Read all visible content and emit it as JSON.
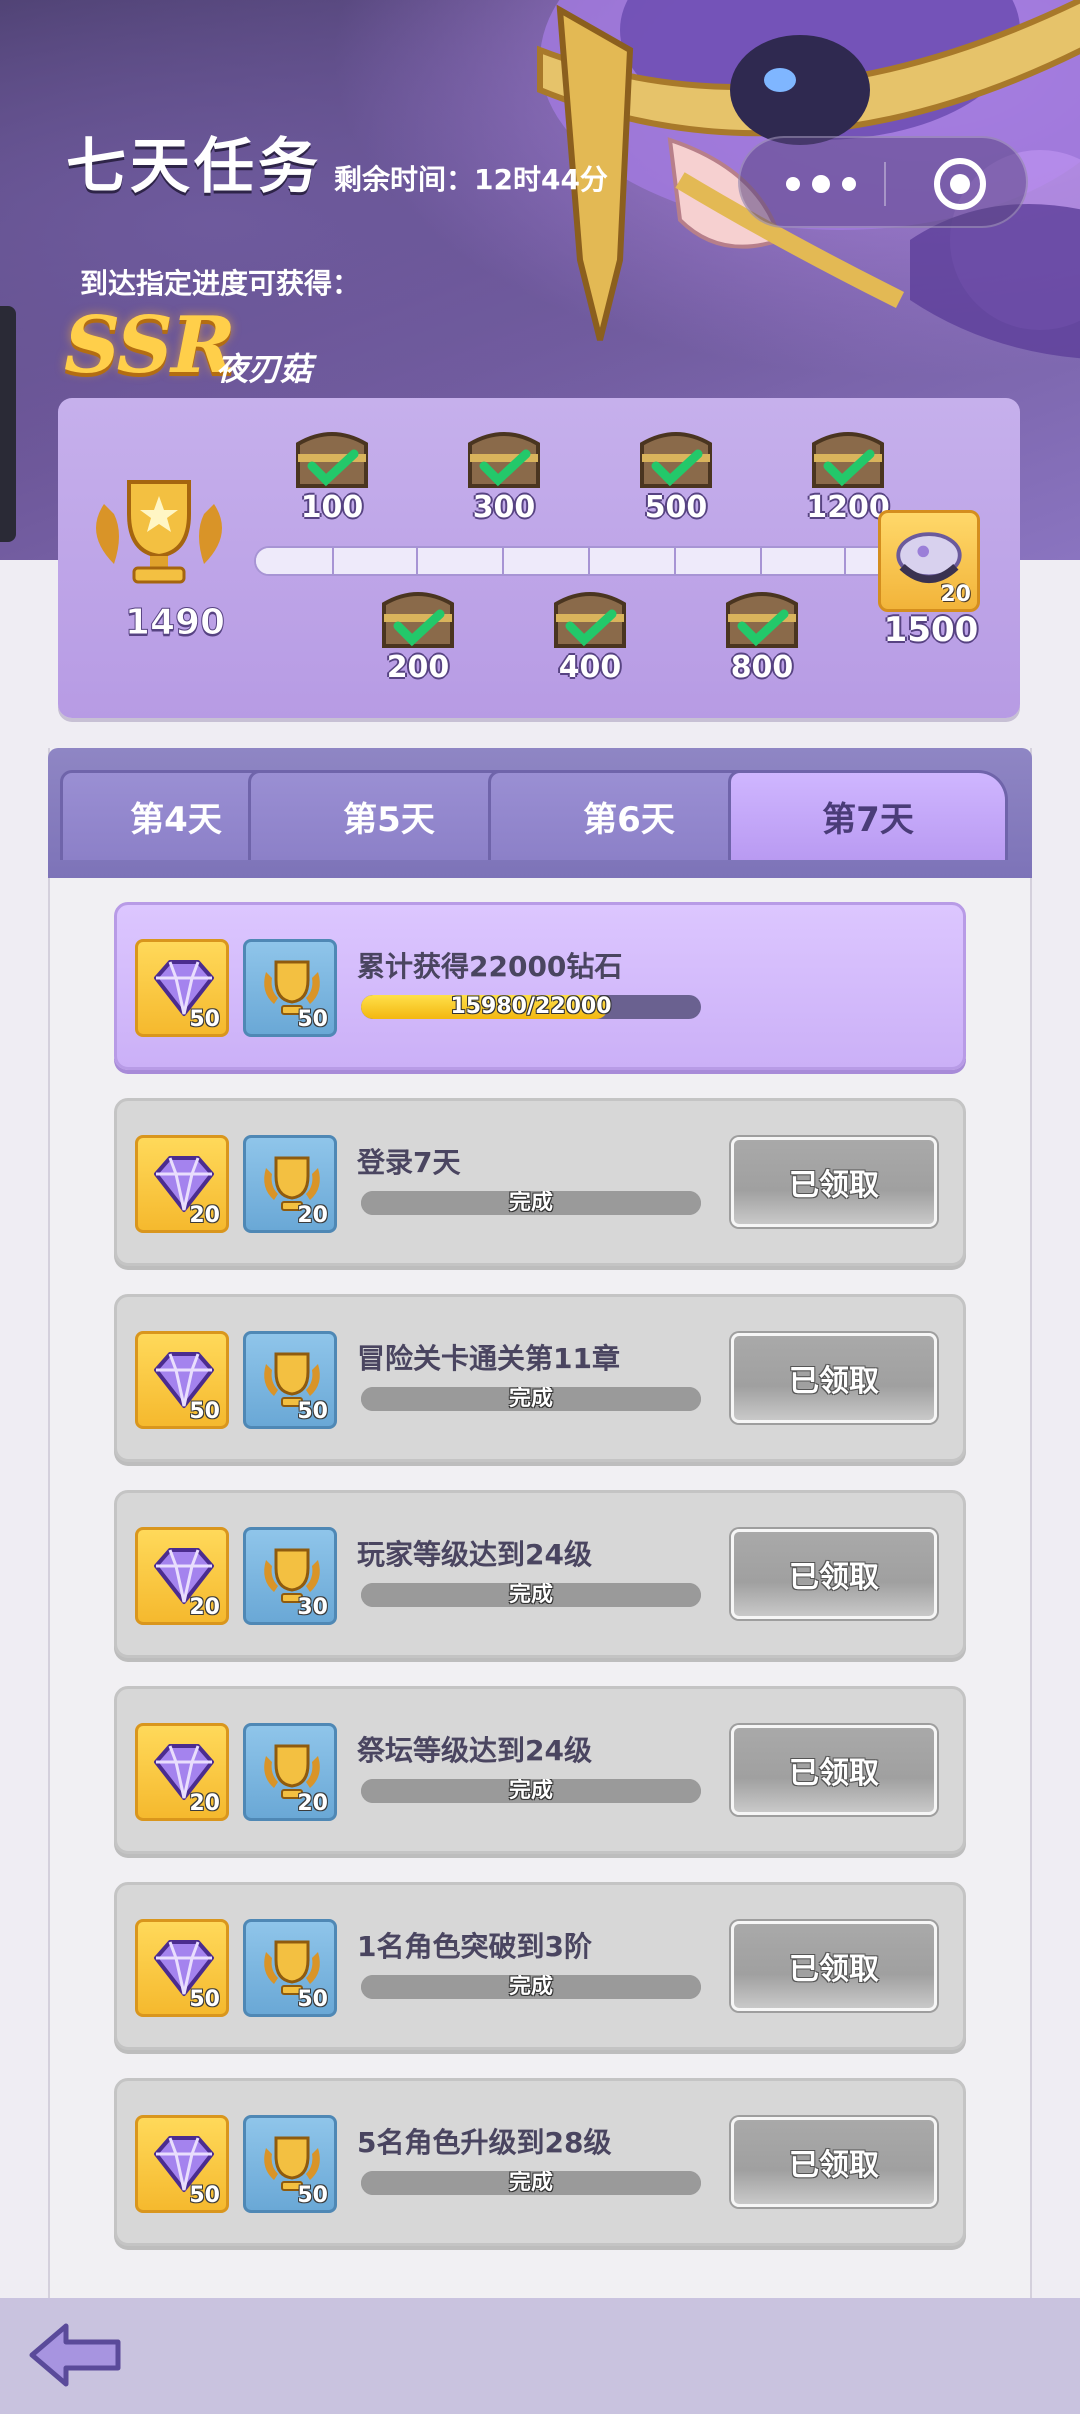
{
  "header": {
    "title": "七天任务",
    "remaining_label": "剩余时间：12时44分",
    "reach_text": "到达指定进度可获得：",
    "reward_rarity": "SSR",
    "reward_name": "夜刃菇"
  },
  "progress": {
    "current_score": "1490",
    "max_score": 1500,
    "milestones_top": [
      "100",
      "300",
      "500",
      "1200"
    ],
    "milestones_bottom": [
      "200",
      "400",
      "800"
    ],
    "final_milestone": "1500",
    "final_item_qty": "20"
  },
  "tabs": [
    {
      "label": "第4天",
      "active": false
    },
    {
      "label": "第5天",
      "active": false
    },
    {
      "label": "第6天",
      "active": false
    },
    {
      "label": "第7天",
      "active": true
    }
  ],
  "tasks": [
    {
      "title": "累计获得22000钻石",
      "gem_qty": "50",
      "cup_qty": "50",
      "progress_text": "15980/22000",
      "progress": 0.7264,
      "claim_label": "",
      "active": true
    },
    {
      "title": "登录7天",
      "gem_qty": "20",
      "cup_qty": "20",
      "progress_text": "完成",
      "progress": 1.0,
      "claim_label": "已领取",
      "active": false
    },
    {
      "title": "冒险关卡通关第11章",
      "gem_qty": "50",
      "cup_qty": "50",
      "progress_text": "完成",
      "progress": 1.0,
      "claim_label": "已领取",
      "active": false
    },
    {
      "title": "玩家等级达到24级",
      "gem_qty": "20",
      "cup_qty": "30",
      "progress_text": "完成",
      "progress": 1.0,
      "claim_label": "已领取",
      "active": false
    },
    {
      "title": "祭坛等级达到24级",
      "gem_qty": "20",
      "cup_qty": "20",
      "progress_text": "完成",
      "progress": 1.0,
      "claim_label": "已领取",
      "active": false
    },
    {
      "title": "1名角色突破到3阶",
      "gem_qty": "50",
      "cup_qty": "50",
      "progress_text": "完成",
      "progress": 1.0,
      "claim_label": "已领取",
      "active": false
    },
    {
      "title": "5名角色升级到28级",
      "gem_qty": "50",
      "cup_qty": "50",
      "progress_text": "完成",
      "progress": 1.0,
      "claim_label": "已领取",
      "active": false
    }
  ],
  "icons": {
    "more": "more-dots-icon",
    "close": "target-close-icon",
    "back": "back-arrow-icon",
    "trophy": "trophy-icon",
    "chest": "chest-claimed-icon",
    "gem": "diamond-icon",
    "cup": "trophy-cup-icon"
  },
  "colors": {
    "accent": "#b99af2",
    "claimed_button": "#a5a5a5",
    "progress_fill": "#f3b710",
    "panel": "#c0a8ea"
  }
}
